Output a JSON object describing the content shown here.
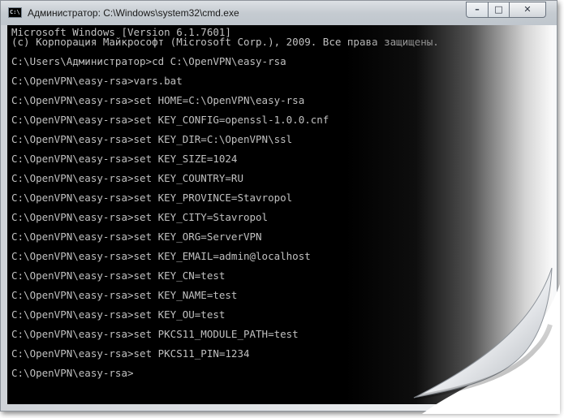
{
  "window": {
    "title": "Администратор: C:\\Windows\\system32\\cmd.exe",
    "icon": "cmd-icon",
    "controls": {
      "minimize": "–",
      "maximize": "□",
      "close": "✕"
    }
  },
  "console": {
    "lines": [
      "Microsoft Windows [Version 6.1.7601]",
      "(c) Корпорация Майкрософт (Microsoft Corp.), 2009. Все права защищены.",
      "",
      "C:\\Users\\Администратор>cd C:\\OpenVPN\\easy-rsa",
      "",
      "C:\\OpenVPN\\easy-rsa>vars.bat",
      "",
      "C:\\OpenVPN\\easy-rsa>set HOME=C:\\OpenVPN\\easy-rsa",
      "",
      "C:\\OpenVPN\\easy-rsa>set KEY_CONFIG=openssl-1.0.0.cnf",
      "",
      "C:\\OpenVPN\\easy-rsa>set KEY_DIR=C:\\OpenVPN\\ssl",
      "",
      "C:\\OpenVPN\\easy-rsa>set KEY_SIZE=1024",
      "",
      "C:\\OpenVPN\\easy-rsa>set KEY_COUNTRY=RU",
      "",
      "C:\\OpenVPN\\easy-rsa>set KEY_PROVINCE=Stavropol",
      "",
      "C:\\OpenVPN\\easy-rsa>set KEY_CITY=Stavropol",
      "",
      "C:\\OpenVPN\\easy-rsa>set KEY_ORG=ServerVPN",
      "",
      "C:\\OpenVPN\\easy-rsa>set KEY_EMAIL=admin@localhost",
      "",
      "C:\\OpenVPN\\easy-rsa>set KEY_CN=test",
      "",
      "C:\\OpenVPN\\easy-rsa>set KEY_NAME=test",
      "",
      "C:\\OpenVPN\\easy-rsa>set KEY_OU=test",
      "",
      "C:\\OpenVPN\\easy-rsa>set PKCS11_MODULE_PATH=test",
      "",
      "C:\\OpenVPN\\easy-rsa>set PKCS11_PIN=1234",
      "",
      "C:\\OpenVPN\\easy-rsa>"
    ]
  },
  "colors": {
    "console_bg": "#000000",
    "console_text": "#c0c0c0",
    "titlebar": "#c5cbd1"
  }
}
